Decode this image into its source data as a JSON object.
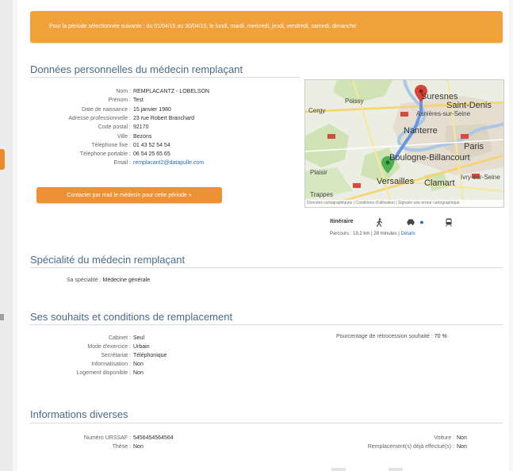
{
  "banner": {
    "text": "Pour la période sélectionnée suivante : du 01/04/15 au 30/04/15, le lundi, mardi, mercredi, jeudi, vendredi, samedi, dimanche"
  },
  "personal": {
    "title": "Données personnelles du médecin remplaçant",
    "fields": [
      {
        "label": "Nom :",
        "value": "REMPLACANTZ - LOBELSON"
      },
      {
        "label": "Prénom :",
        "value": "Test"
      },
      {
        "label": "Date de naissance :",
        "value": "15 janvier 1980"
      },
      {
        "label": "Adresse professionnelle :",
        "value": "23 rue Robert Branchard"
      },
      {
        "label": "Code postal :",
        "value": "92170"
      },
      {
        "label": "Ville :",
        "value": "Bezons"
      },
      {
        "label": "Téléphone fixe :",
        "value": "01 43 52 54 54"
      },
      {
        "label": "Téléphone portable :",
        "value": "06 54 25 65 65"
      },
      {
        "label": "Email :",
        "value": "remplacant2@datapulle.com"
      }
    ],
    "cta_label": "Contacter par mail le médecin pour cette période »"
  },
  "map": {
    "labels": {
      "suresnes": "Suresnes",
      "saint_denis": "Saint-Denis",
      "asnieres": "Asnières-sur-Seine",
      "nanterre": "Nanterre",
      "paris": "Paris",
      "boulogne": "Boulogne-Billancourt",
      "versailles": "Versailles",
      "clamart": "Clamart",
      "ivry": "Ivry-sur-Seine",
      "trappes": "Trappes",
      "cergy": "Cergy",
      "poissy": "Poissy",
      "plaisir": "Plaisir"
    },
    "footer": "Données cartographiques | Conditions d'utilisation | Signaler une erreur cartographique"
  },
  "route": {
    "itinerary_label": "Itinéraire",
    "modes": [
      "walk-icon",
      "car-icon",
      "transit-icon"
    ],
    "info_prefix": "Parcours : 19,2 km | 28 minutes |",
    "details_link": "Détails"
  },
  "specialty": {
    "title": "Spécialité du médecin remplaçant",
    "label": "Sa spécialité :",
    "value": "Médecine générale"
  },
  "wishes": {
    "title": "Ses souhaits et conditions de remplacement",
    "fields": [
      {
        "label": "Cabinet :",
        "value": "Seul"
      },
      {
        "label": "Mode d'exercice :",
        "value": "Urbain"
      },
      {
        "label": "Secrétariat :",
        "value": "Téléphonique"
      },
      {
        "label": "Informatisation :",
        "value": "Non"
      },
      {
        "label": "Logement disponible :",
        "value": "Non"
      }
    ],
    "retro_label": "Pourcentage de rétrocession souhaité :",
    "retro_value": "70 %"
  },
  "misc": {
    "title": "Informations diverses",
    "fields_left": [
      {
        "label": "Numéro URSSAF :",
        "value": "5456454564564"
      },
      {
        "label": "Thèse :",
        "value": "Non"
      }
    ],
    "fields_right": [
      {
        "label": "Voiture :",
        "value": "Non"
      },
      {
        "label": "Remplacement(s) déjà effectué(s) :",
        "value": "Non"
      }
    ]
  }
}
